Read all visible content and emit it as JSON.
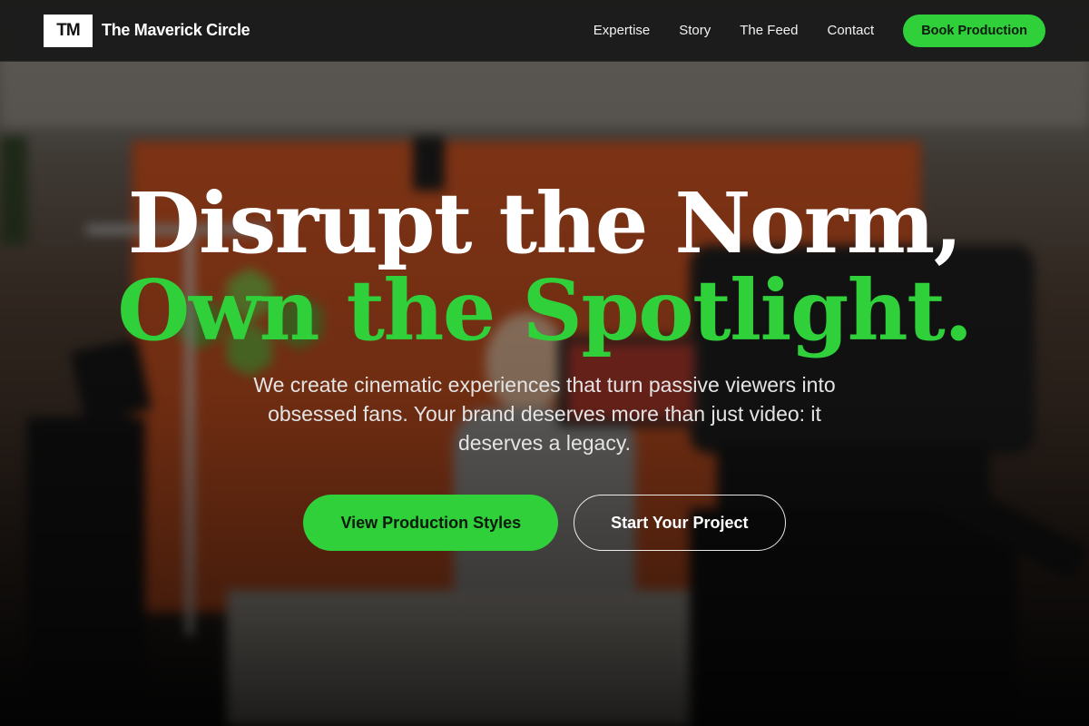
{
  "header": {
    "logo_mark": "TM",
    "brand_name": "The Maverick Circle",
    "nav": [
      {
        "label": "Expertise"
      },
      {
        "label": "Story"
      },
      {
        "label": "The Feed"
      },
      {
        "label": "Contact"
      }
    ],
    "cta_label": "Book Production"
  },
  "hero": {
    "headline_line1": "Disrupt the Norm,",
    "headline_line2": "Own the Spotlight.",
    "subcopy": "We create cinematic experiences that turn passive viewers into obsessed fans. Your brand deserves more than just video: it deserves a legacy.",
    "primary_cta": "View Production Styles",
    "secondary_cta": "Start Your Project"
  },
  "colors": {
    "accent": "#2fd03a",
    "header_bg": "#181818",
    "text": "#ffffff"
  }
}
